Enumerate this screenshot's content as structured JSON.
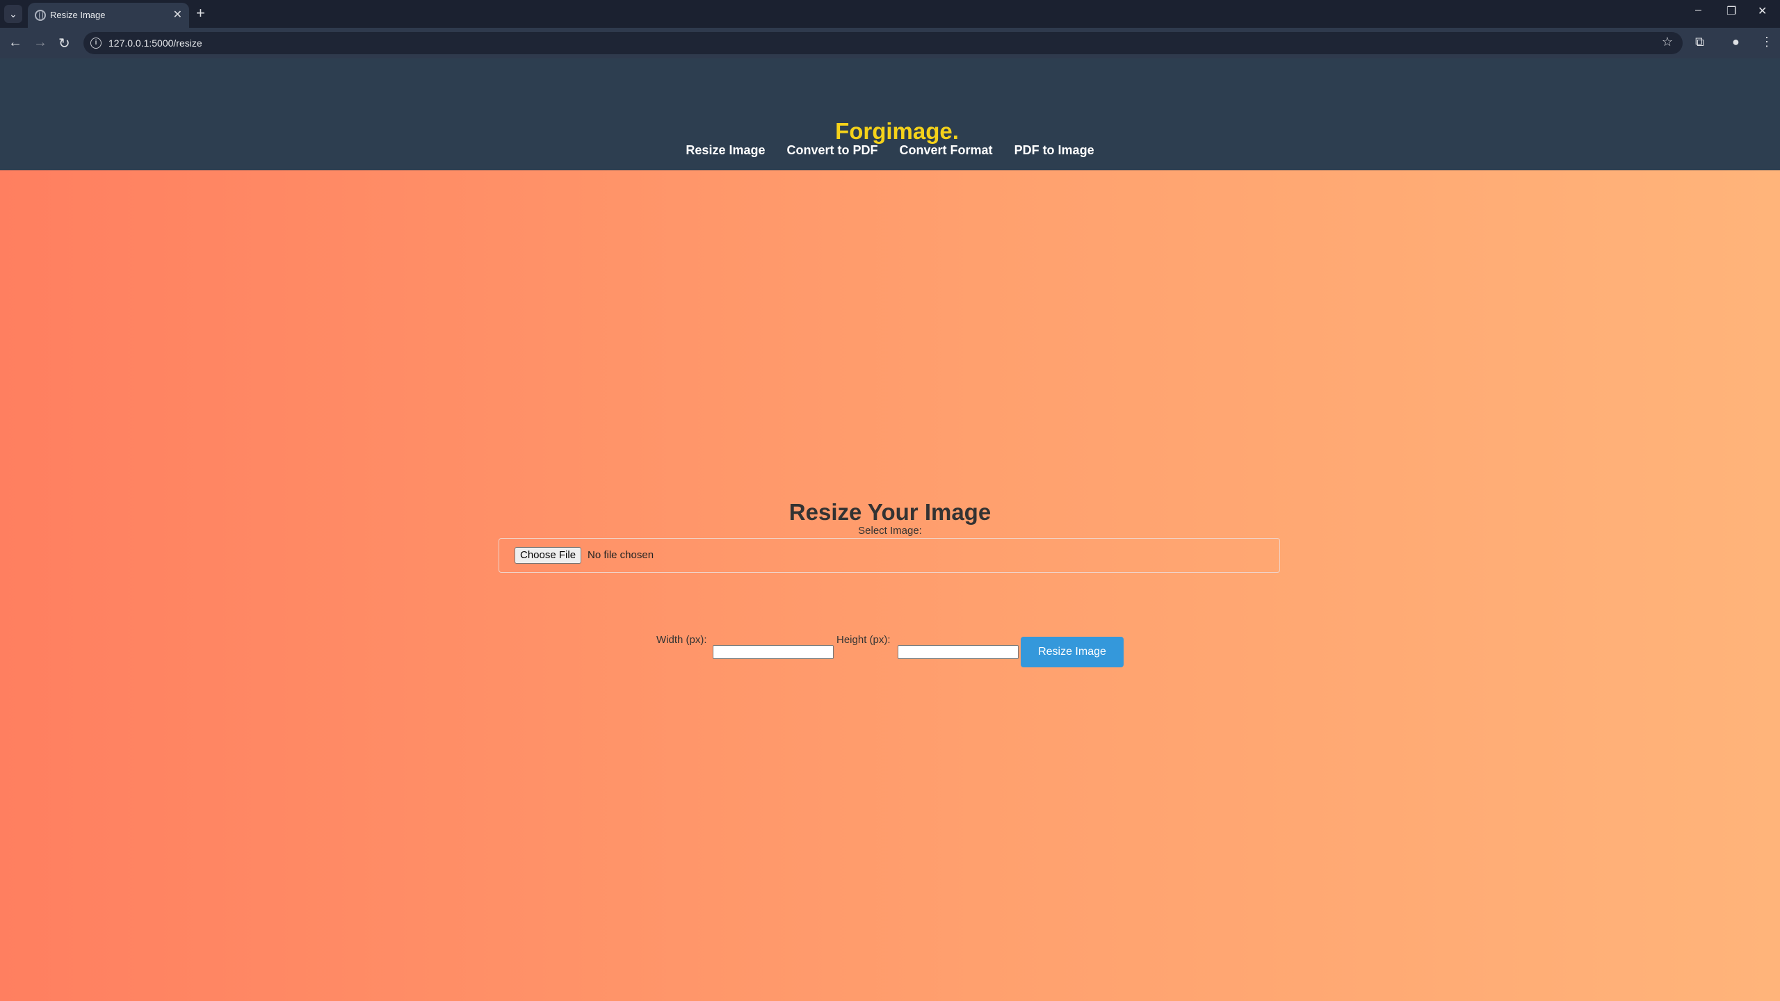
{
  "browser": {
    "tab_title": "Resize Image",
    "tab_close": "✕",
    "new_tab": "+",
    "url": "127.0.0.1:5000/resize",
    "window_controls": {
      "minimize": "–",
      "restore": "❐",
      "close": "✕"
    }
  },
  "header": {
    "logo": "Forgimage.",
    "logo_color": "#f5d21a",
    "nav": [
      {
        "label": "Resize Image"
      },
      {
        "label": "Convert to PDF"
      },
      {
        "label": "Convert Format"
      },
      {
        "label": "PDF to Image"
      }
    ]
  },
  "form": {
    "title": "Resize Your Image",
    "select_label": "Select Image:",
    "file_button": "Choose File",
    "file_status": "No file chosen",
    "width_label": "Width (px):",
    "width_value": "",
    "height_label": "Height (px):",
    "height_value": "",
    "submit_label": "Resize Image",
    "submit_color": "#3498db"
  }
}
